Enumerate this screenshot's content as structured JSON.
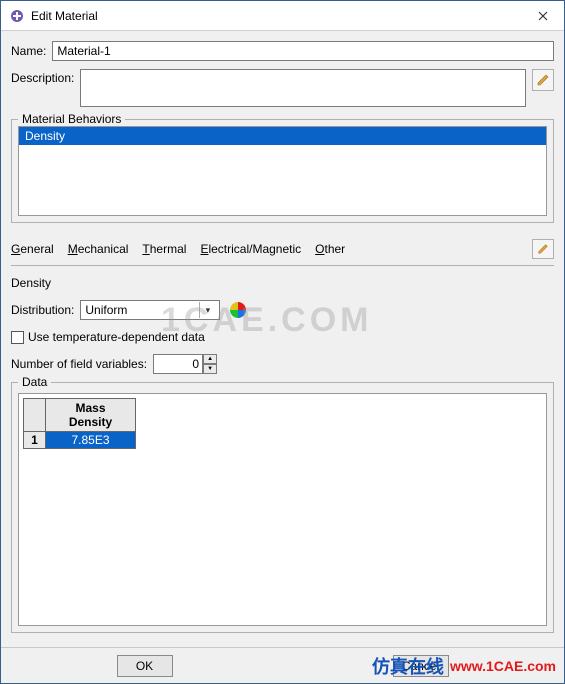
{
  "window": {
    "title": "Edit Material"
  },
  "fields": {
    "name_label": "Name:",
    "name_value": "Material-1",
    "description_label": "Description:",
    "description_value": ""
  },
  "behaviors": {
    "legend": "Material Behaviors",
    "items": [
      "Density"
    ],
    "selected": 0
  },
  "menu": {
    "general": "General",
    "mechanical": "Mechanical",
    "thermal": "Thermal",
    "electmag": "Electrical/Magnetic",
    "other": "Other"
  },
  "density": {
    "section_title": "Density",
    "distribution_label": "Distribution:",
    "distribution_value": "Uniform",
    "use_temp_label": "Use temperature-dependent data",
    "use_temp_checked": false,
    "field_vars_label": "Number of field variables:",
    "field_vars_value": "0"
  },
  "data": {
    "legend": "Data",
    "columns": [
      "Mass\nDensity"
    ],
    "rows": [
      {
        "n": "1",
        "cells": [
          "7.85E3"
        ]
      }
    ]
  },
  "buttons": {
    "ok": "OK",
    "cancel": "Cancel"
  },
  "watermark": {
    "text1": "1CAE.COM",
    "cn": "仿真在线",
    "url": "www.1CAE.com"
  }
}
